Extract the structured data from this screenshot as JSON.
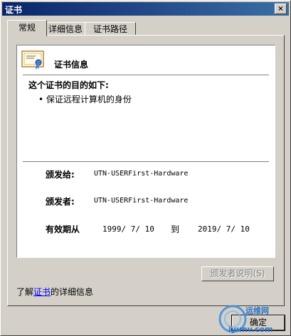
{
  "window": {
    "title": "证书",
    "close_glyph": "×"
  },
  "tabs": [
    {
      "label": "常规",
      "active": true
    },
    {
      "label": "详细信息",
      "active": false
    },
    {
      "label": "证书路径",
      "active": false
    }
  ],
  "cert": {
    "heading": "证书信息",
    "purpose_heading": "这个证书的目的如下:",
    "purposes": [
      "保证远程计算机的身份"
    ],
    "issued_to_label": "颁发给:",
    "issued_to": "UTN-USERFirst-Hardware",
    "issued_by_label": "颁发者:",
    "issued_by": "UTN-USERFirst-Hardware",
    "validity_label": "有效期从",
    "valid_from": "1999/ 7/ 10",
    "to_label": "到",
    "valid_to": "2019/ 7/ 10"
  },
  "issuer_statement_button": "颁发者说明(S)",
  "footer": {
    "prefix": "了解",
    "link": "证书",
    "suffix": "的详细信息"
  },
  "ok_button": "确定",
  "watermark": {
    "line1": "运维网",
    "line2": "iyunv.com"
  },
  "colors": {
    "titlebar": "#0a246a",
    "link": "#0000ff",
    "face": "#d4d0c8"
  }
}
